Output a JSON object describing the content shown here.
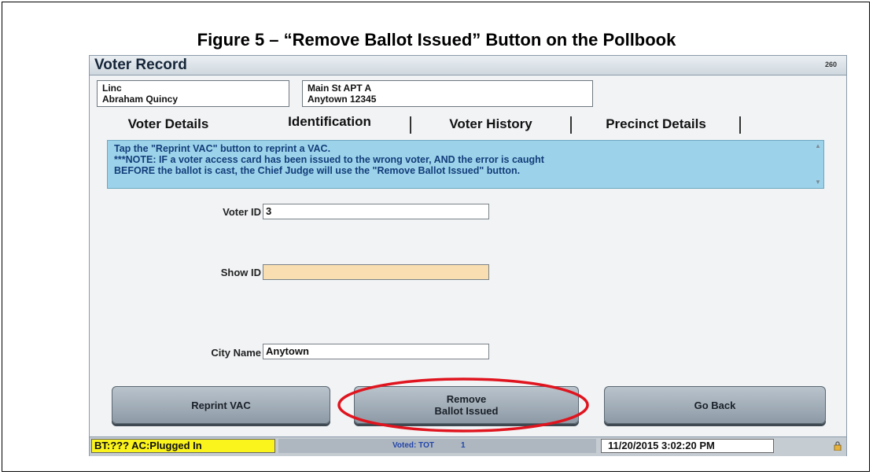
{
  "figure": {
    "caption": "Figure 5 – “Remove Ballot Issued” Button on the Pollbook"
  },
  "window": {
    "title": "Voter Record",
    "screen_code": "260"
  },
  "voter": {
    "name_line1": "Linc",
    "name_line2": "Abraham Quincy",
    "address_line1": "Main St APT A",
    "address_line2": "Anytown 12345"
  },
  "tabs": [
    {
      "label": "Voter Details",
      "active": false
    },
    {
      "label": "Identification",
      "active": true
    },
    {
      "label": "Voter History",
      "active": false
    },
    {
      "label": "Precinct Details",
      "active": false
    }
  ],
  "note": {
    "line1": "Tap the \"Reprint VAC\"  button to reprint a VAC.",
    "line2": "***NOTE: IF a voter access card has been issued to the wrong voter, AND the error is caught",
    "line3": "BEFORE the ballot is cast, the Chief Judge will use the \"Remove Ballot Issued\" button."
  },
  "fields": {
    "voter_id": {
      "label": "Voter ID",
      "value": "3"
    },
    "show_id": {
      "label": "Show ID",
      "value": ""
    },
    "city_name": {
      "label": "City Name",
      "value": "Anytown"
    }
  },
  "buttons": {
    "reprint": "Reprint VAC",
    "remove_line1": "Remove",
    "remove_line2": "Ballot Issued",
    "go_back": "Go Back"
  },
  "status": {
    "power": "BT:??? AC:Plugged In",
    "voted_label": "Voted: TOT",
    "voted_count": "1",
    "datetime": "11/20/2015 3:02:20 PM"
  },
  "colors": {
    "note_bg": "#9dd3ea",
    "power_bg": "#fbf31c",
    "highlight_field": "#f8deb0",
    "annotation": "#e0141e"
  },
  "icons": {
    "scroll_up": "chevron-up-icon",
    "scroll_down": "chevron-down-icon",
    "status_lock": "lock-icon"
  }
}
